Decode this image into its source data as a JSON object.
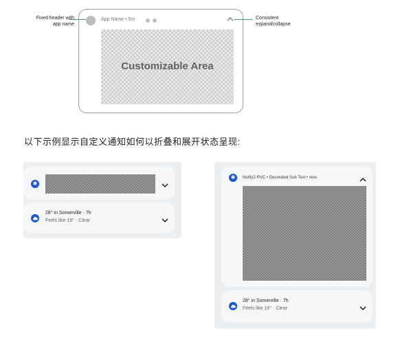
{
  "diagram": {
    "header_app_text": "App Name • 5m",
    "area_label": "Customizable Area",
    "callout_left": [
      "Fixed header with",
      "app name"
    ],
    "callout_right": [
      "Consistent",
      "expand/collapse"
    ]
  },
  "caption": "以下示例显示自定义通知如何以折叠和展开状态呈现:",
  "collapsed": {
    "weather": {
      "title": "28° in Somerville · 7h",
      "subtitle": "Feels like 16° · Clear"
    }
  },
  "expanded": {
    "header": "Notify2-RVC • Decorated Sub Text • now",
    "weather": {
      "title": "28° in Somerville · 7h",
      "subtitle": "Feels like 16° · Clear"
    }
  },
  "icons": {
    "chevron_down": "chevron-down-icon",
    "chevron_up": "chevron-up-icon",
    "app": "app-icon",
    "weather": "cloud-icon"
  },
  "colors": {
    "accent": "#1a56d6",
    "callout": "#4a9488"
  }
}
